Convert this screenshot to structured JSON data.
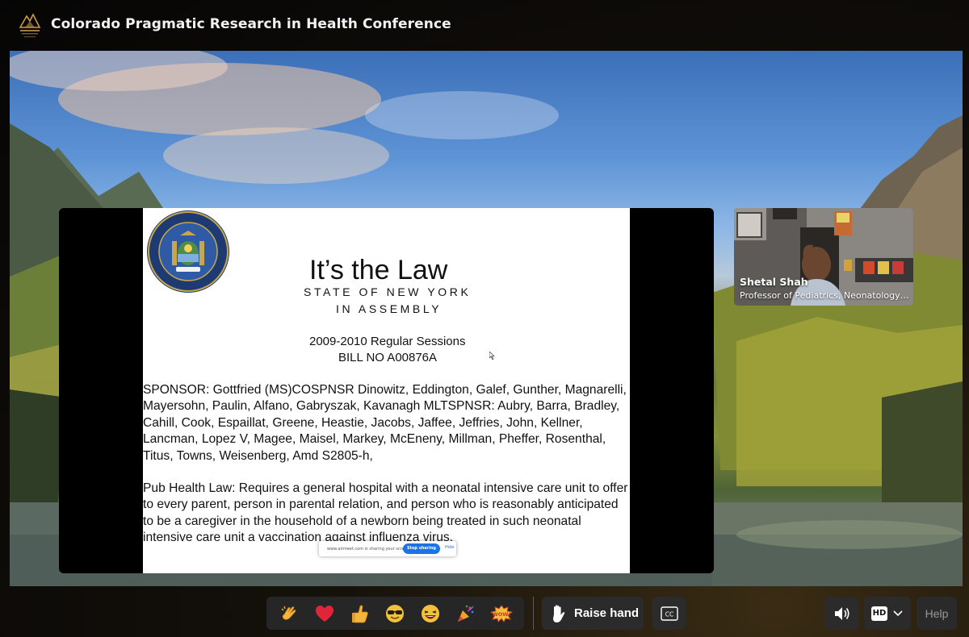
{
  "header": {
    "title": "Colorado Pragmatic Research in Health Conference"
  },
  "slide": {
    "title": "It’s the Law",
    "subtitle_1": "STATE OF NEW YORK",
    "subtitle_2": "IN ASSEMBLY",
    "sessions": "2009-2010 Regular Sessions",
    "bill": "BILL NO A00876A",
    "sponsor": "SPONSOR: Gottfried (MS)COSPNSR    Dinowitz, Eddington, Galef, Gunther, Magnarelli, Mayersohn, Paulin,  Alfano, Gabryszak, Kavanagh MLTSPNSR: Aubry, Barra, Bradley, Cahill, Cook, Espaillat, Greene, Heastie, Jacobs, Jaffee, Jeffries, John, Kellner, Lancman, Lopez V, Magee, Maisel, Markey, McEneny, Millman, Pheffer, Rosenthal, Titus, Towns, Weisenberg, Amd S2805-h,",
    "pub_health": "Pub Health Law: Requires a general hospital with a neonatal intensive care unit to offer to every parent, person in parental relation, and person who is reasonably anticipated to be a caregiver in the household of a newborn being treated in such neonatal intensive care unit a vaccination against influenza virus.",
    "sharebar_text": "www.airmeet.com is sharing your screen.",
    "stop_sharing": "Stop sharing",
    "hide": "Hide"
  },
  "speaker": {
    "name": "Shetal Shah",
    "role": "Professor of Pediatrics, Neonatology, SUNY"
  },
  "toolbar": {
    "reactions": [
      "clapping-hands",
      "heart",
      "thumbs-up",
      "cool-face",
      "laughing-face",
      "party-popper",
      "wow"
    ],
    "wow_label": "WOW!",
    "raise_hand_label": "Raise hand",
    "cc_label": "CC",
    "hd_label": "HD",
    "help_label": "Help"
  },
  "colors": {
    "accent_blue": "#1a73e8",
    "heart_red": "#e0243a",
    "toolbar_bg": "#2b2b2b"
  }
}
